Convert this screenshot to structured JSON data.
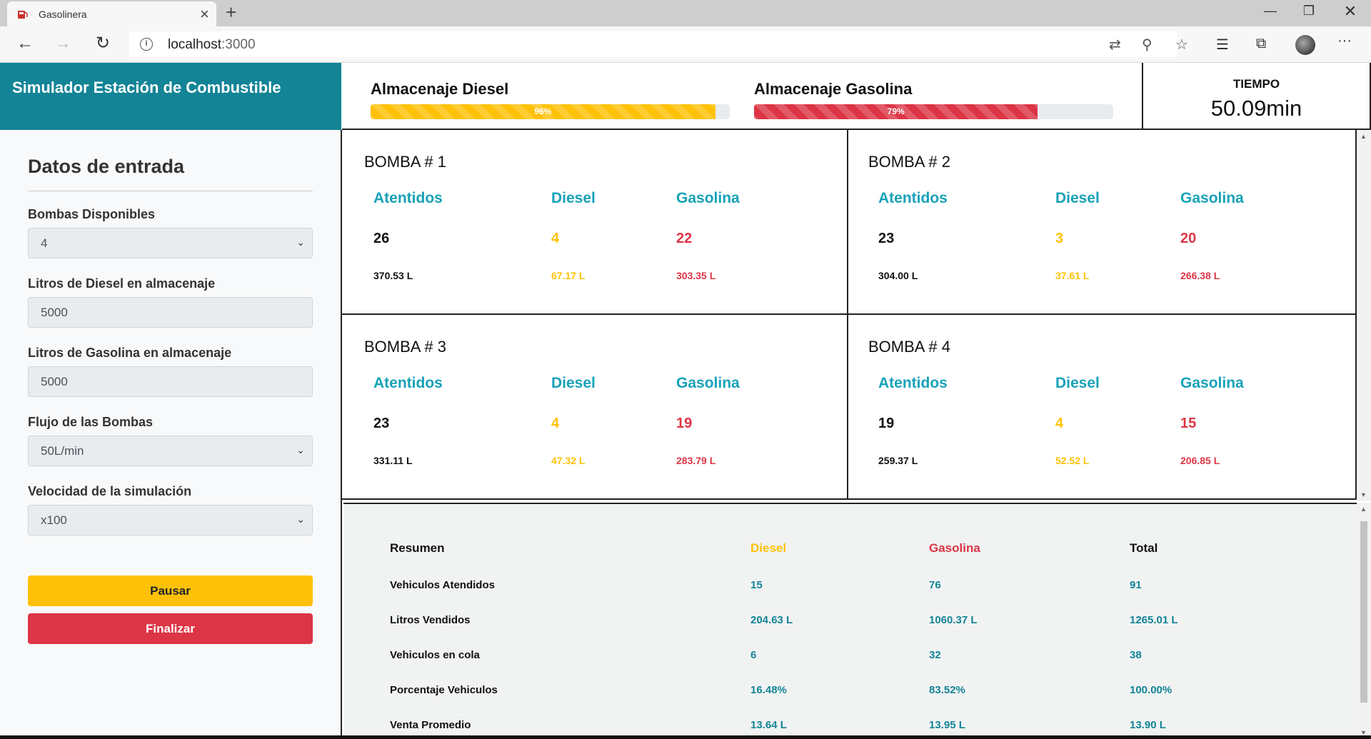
{
  "browser": {
    "tab_title": "Gasolinera",
    "url_host": "localhost",
    "url_port": ":3000"
  },
  "header": {
    "title": "Simulador Estación de Combustible",
    "diesel": {
      "label": "Almacenaje Diesel",
      "percent_text": "96%",
      "level": 0.96,
      "color": "#ffc107"
    },
    "gasolina": {
      "label": "Almacenaje Gasolina",
      "percent_text": "79%",
      "level": 0.79,
      "color": "#dc3545"
    },
    "time": {
      "label": "TIEMPO",
      "value": "50.09min"
    }
  },
  "sidebar": {
    "title": "Datos de entrada",
    "fields": [
      {
        "label": "Bombas Disponibles",
        "value": "4",
        "type": "select"
      },
      {
        "label": "Litros de Diesel en almacenaje",
        "value": "5000",
        "type": "input"
      },
      {
        "label": "Litros de Gasolina en almacenaje",
        "value": "5000",
        "type": "input"
      },
      {
        "label": "Flujo de las Bombas",
        "value": "50L/min",
        "type": "select"
      },
      {
        "label": "Velocidad de la simulación",
        "value": "x100",
        "type": "select"
      }
    ],
    "pause_label": "Pausar",
    "finish_label": "Finalizar"
  },
  "pump_headers": {
    "attended": "Atentidos",
    "diesel": "Diesel",
    "gasolina": "Gasolina"
  },
  "pumps": [
    {
      "title": "BOMBA # 1",
      "attended": "26",
      "attended_liters": "370.53 L",
      "diesel": "4",
      "diesel_liters": "67.17 L",
      "gasolina": "22",
      "gasolina_liters": "303.35 L"
    },
    {
      "title": "BOMBA # 2",
      "attended": "23",
      "attended_liters": "304.00 L",
      "diesel": "3",
      "diesel_liters": "37.61 L",
      "gasolina": "20",
      "gasolina_liters": "266.38 L"
    },
    {
      "title": "BOMBA # 3",
      "attended": "23",
      "attended_liters": "331.11 L",
      "diesel": "4",
      "diesel_liters": "47.32 L",
      "gasolina": "19",
      "gasolina_liters": "283.79 L"
    },
    {
      "title": "BOMBA # 4",
      "attended": "19",
      "attended_liters": "259.37 L",
      "diesel": "4",
      "diesel_liters": "52.52 L",
      "gasolina": "15",
      "gasolina_liters": "206.85 L"
    }
  ],
  "summary": {
    "headers": [
      "Resumen",
      "Diesel",
      "Gasolina",
      "Total"
    ],
    "rows": [
      {
        "label": "Vehiculos Atendidos",
        "diesel": "15",
        "gasolina": "76",
        "total": "91"
      },
      {
        "label": "Litros Vendidos",
        "diesel": "204.63 L",
        "gasolina": "1060.37 L",
        "total": "1265.01 L"
      },
      {
        "label": "Vehiculos en cola",
        "diesel": "6",
        "gasolina": "32",
        "total": "38"
      },
      {
        "label": "Porcentaje Vehiculos",
        "diesel": "16.48%",
        "gasolina": "83.52%",
        "total": "100.00%"
      },
      {
        "label": "Venta Promedio",
        "diesel": "13.64 L",
        "gasolina": "13.95 L",
        "total": "13.90 L"
      }
    ]
  }
}
